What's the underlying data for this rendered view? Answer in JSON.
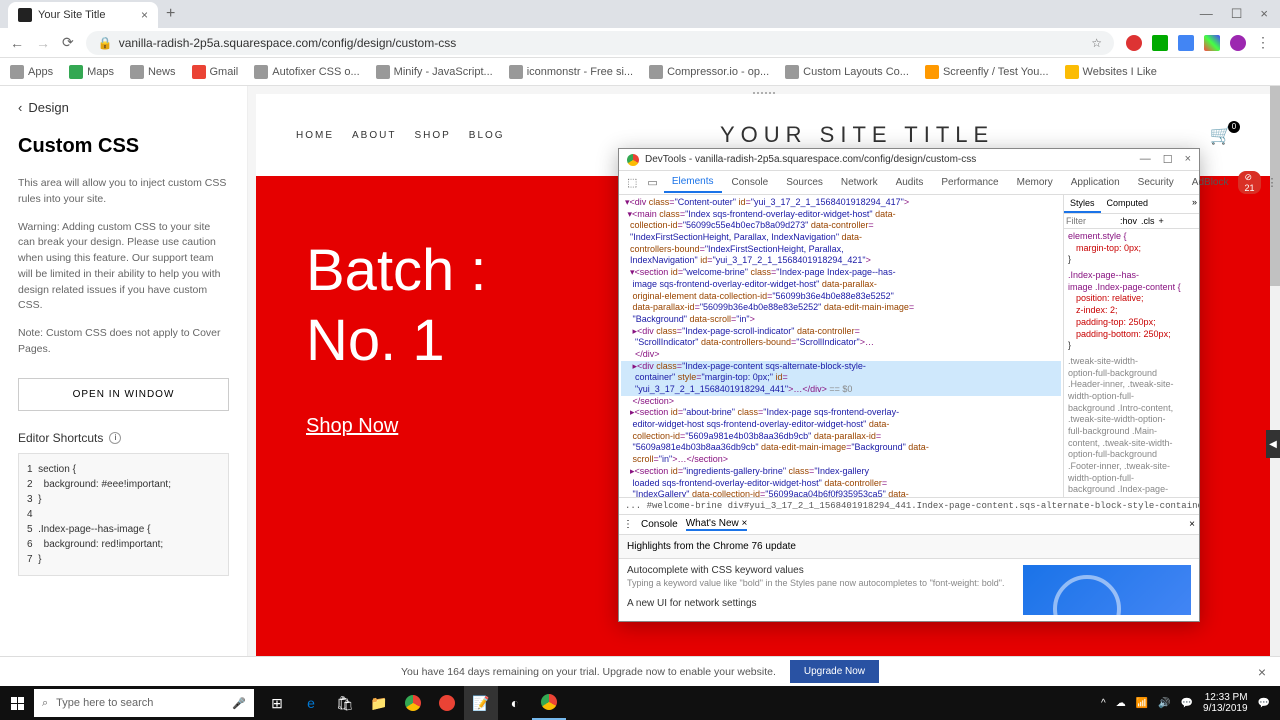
{
  "browser": {
    "tab_title": "Your Site Title",
    "url": "vanilla-radish-2p5a.squarespace.com/config/design/custom-css",
    "bookmarks": [
      "Apps",
      "Maps",
      "News",
      "Gmail",
      "Autofixer CSS o...",
      "Minify - JavaScript...",
      "iconmonstr - Free si...",
      "Compressor.io - op...",
      "Custom Layouts Co...",
      "Screenfly / Test You...",
      "Websites I Like"
    ]
  },
  "sidebar": {
    "back": "Design",
    "title": "Custom CSS",
    "desc1": "This area will allow you to inject custom CSS rules into your site.",
    "desc2": "Warning: Adding custom CSS to your site can break your design. Please use caution when using this feature. Our support team will be limited in their ability to help you with design related issues if you have custom CSS.",
    "desc3": "Note: Custom CSS does not apply to Cover Pages.",
    "open_btn": "OPEN IN WINDOW",
    "shortcuts": "Editor Shortcuts",
    "code": "section {\n  background: #eee!important;\n}\n\n.Index-page--has-image {\n  background: red!important;\n}"
  },
  "site": {
    "nav": [
      "HOME",
      "ABOUT",
      "SHOP",
      "BLOG"
    ],
    "title": "YOUR SITE TITLE",
    "cart_count": "0",
    "hero_line1": "Batch :",
    "hero_line2": "No. 1",
    "hero_cta": "Shop Now"
  },
  "devtools": {
    "title": "DevTools - vanilla-radish-2p5a.squarespace.com/config/design/custom-css",
    "tabs": [
      "Elements",
      "Console",
      "Sources",
      "Network",
      "Audits",
      "Performance",
      "Memory",
      "Application",
      "Security",
      "AdBlock"
    ],
    "error_count": "21",
    "styles_tabs": [
      "Styles",
      "Computed"
    ],
    "filter_ph": "Filter",
    "hov": ":hov",
    "cls": ".cls",
    "breadcrumb": "... #welcome-brine  div#yui_3_17_2_1_1568401918294_441.Index-page-content.sqs-alternate-block-style-container",
    "console_tabs": [
      "Console",
      "What's New"
    ],
    "highlights": "Highlights from the Chrome 76 update",
    "feat1_title": "Autocomplete with CSS keyword values",
    "feat1_desc": "Typing a keyword value like \"bold\" in the Styles pane now autocompletes to \"font-weight: bold\".",
    "feat2_title": "A new UI for network settings"
  },
  "trial": {
    "text": "You have 164 days remaining on your trial. Upgrade now to enable your website.",
    "btn": "Upgrade Now"
  },
  "taskbar": {
    "search_ph": "Type here to search",
    "time": "12:33 PM",
    "date": "9/13/2019"
  }
}
